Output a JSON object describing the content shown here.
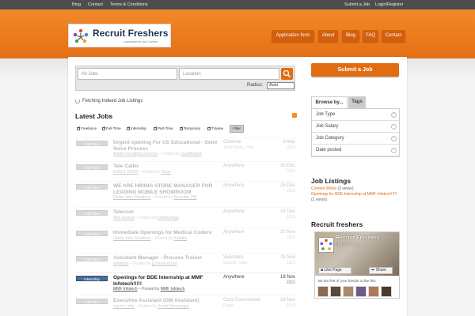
{
  "topbar": {
    "left_links": [
      "Blog",
      "Contact",
      "Terms & Conditions"
    ],
    "right_links": [
      "Submit a Job",
      "Login/Register"
    ]
  },
  "logo": {
    "title": "Recruit Freshers",
    "tagline": "Launchpad for your Careers"
  },
  "nav": [
    "Application form",
    "About",
    "Blog",
    "FAQ",
    "Contact"
  ],
  "search": {
    "jobs_placeholder": "All Jobs",
    "location_placeholder": "Location",
    "radius_label": "Radius:",
    "radius_value": "Auto"
  },
  "status": {
    "fetching": "Fetching Indeed Job Listings"
  },
  "latest": {
    "heading": "Latest Jobs",
    "filters": [
      "Freelance",
      "Full-Time",
      "Internship",
      "Part-Time",
      "Temporary",
      "Trainee"
    ],
    "filter_button": "Filter"
  },
  "jobs": [
    {
      "type": "Full-Time",
      "title": "Urgent opening For US Educational - Semi Voice Process",
      "meta_company": "Aashir recruiting services",
      "posted_by": "Posted by",
      "poster": "aruddhakmt",
      "location": "Chennai",
      "location2": "Tamil Nadu, India",
      "date": "8 Mar",
      "year": "2016",
      "faded": true
    },
    {
      "type": "Full-Time",
      "title": "Tele Caller",
      "meta_company": "ERM & SONS",
      "posted_by": "Posted by",
      "poster": "Tarun",
      "location": "Anywhere",
      "location2": "",
      "date": "30 Dec",
      "year": "2015",
      "faded": true
    },
    {
      "type": "Full-Time",
      "title": "WE ARE HIRING STORE MANAGER FOR LEADING MOBILE SHOWROOM",
      "meta_company": "Globe Jobs Solutions",
      "posted_by": "Posted by",
      "poster": "Recruiter HR",
      "location": "Anywhere",
      "location2": "",
      "date": "25 Dec",
      "year": "2015",
      "faded": true
    },
    {
      "type": "Full-Time",
      "title": "Telecom",
      "meta_company": "Tele domine",
      "posted_by": "Posted by",
      "poster": "kathila teiga",
      "location": "Anywhere",
      "location2": "",
      "date": "14 Dec",
      "year": "2015",
      "faded": true
    },
    {
      "type": "Full-Time",
      "title": "Immediate Openings for Medical Coders",
      "meta_company": "Globe Jobs Solutions",
      "posted_by": "Posted by",
      "poster": "Kathika",
      "location": "Anywhere",
      "location2": "",
      "date": "30 Nov",
      "year": "2015",
      "faded": true
    },
    {
      "type": "Full-Time",
      "title": "Assistant Manager - Process Trainer",
      "meta_company": "solidjobs",
      "posted_by": "Posted by",
      "poster": "gcoman rozed",
      "location": "Vadodara",
      "location2": "Gujarat, India",
      "date": "25 Nov",
      "year": "2015",
      "faded": true
    },
    {
      "type": "Internship",
      "title": "Openings for BDE Internship at MMF Infotech!!!!!",
      "meta_company": "MMF Infotech",
      "posted_by": "Posted by",
      "poster": "MMF Infotech",
      "location": "Anywhere",
      "location2": "",
      "date": "18 Nov",
      "year": "2015",
      "faded": false
    },
    {
      "type": "Full-Time",
      "title": "Executive Assistant (GM Assistant)",
      "meta_company": "out of c jobs",
      "posted_by": "Posted by",
      "poster": "Smart Messenger",
      "location": "Giza Governorate",
      "location2": "Egypt",
      "date": "16 Nov",
      "year": "2015",
      "faded": true
    }
  ],
  "sidebar": {
    "submit_button": "Submit a Job",
    "tab_browse": "Browse by...",
    "tab_tags": "Tags",
    "browse_items": [
      "Job Type",
      "Job Salary",
      "Job Category",
      "Date posted"
    ],
    "listings_heading": "Job Listings",
    "listing1": "Content Writer",
    "listing1_views": "(3 views)",
    "listing2": "Openings for BDE Internship at MMF Infotech!!!!!",
    "listing2_views": "(2 views)",
    "freshers_heading": "Recruit freshers",
    "fb_name": "Recruit Freshers",
    "fb_likes": "280,871 likes",
    "fb_like_button": "Like Page",
    "fb_share_button": "Share",
    "fb_text": "Be the first of your friends to like this"
  },
  "colors": {
    "accent": "#e06d12",
    "header": "#ee7f22",
    "topbar": "#4d4d4d"
  }
}
